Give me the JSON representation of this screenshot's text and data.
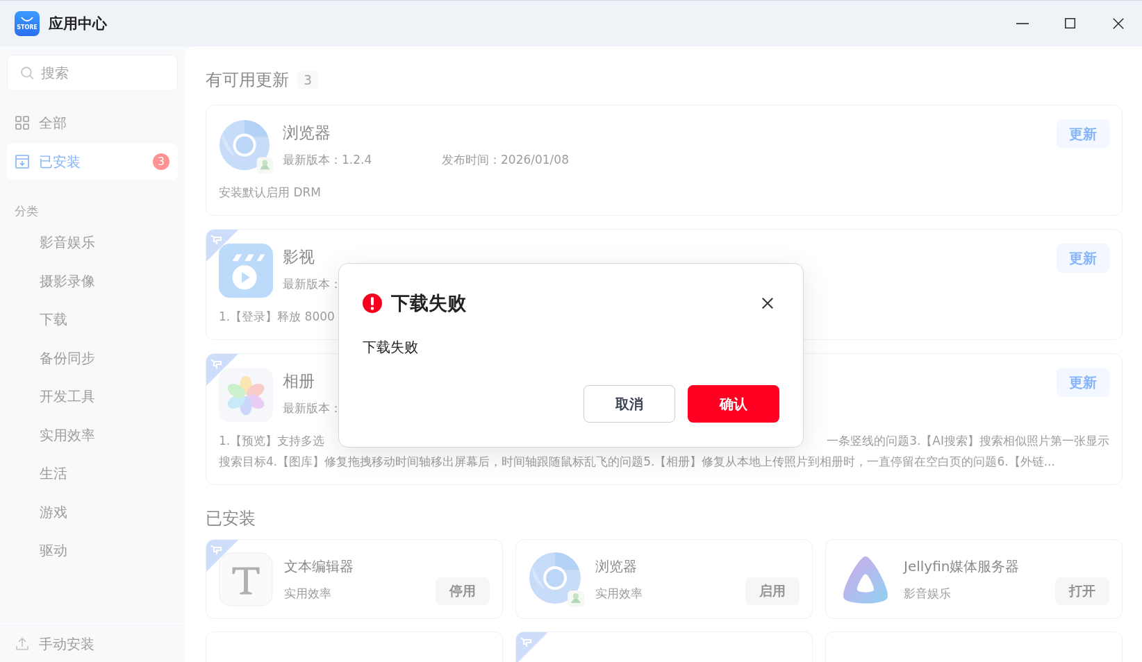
{
  "window": {
    "title": "应用中心",
    "logo_text": "STORE"
  },
  "sidebar": {
    "search": {
      "placeholder": "搜索"
    },
    "nav": [
      {
        "label": "全部",
        "selected": false
      },
      {
        "label": "已安装",
        "selected": true,
        "badge": "3"
      }
    ],
    "category_heading": "分类",
    "categories": [
      "影音娱乐",
      "摄影录像",
      "下载",
      "备份同步",
      "开发工具",
      "实用效率",
      "生活",
      "游戏",
      "驱动"
    ],
    "footer": "手动安装"
  },
  "updates": {
    "title": "有可用更新",
    "count": "3",
    "apps": [
      {
        "name": "浏览器",
        "kind": "browser",
        "tagged": false,
        "version": "最新版本：1.2.4",
        "released": "发布时间：2026/01/08",
        "description": [
          "安装默认启用 DRM"
        ],
        "button": "更新"
      },
      {
        "name": "影视",
        "kind": "video",
        "tagged": true,
        "version": "最新版本：",
        "description": [
          "1.【登录】释放 8000"
        ],
        "button": "更新"
      },
      {
        "name": "相册",
        "kind": "photos",
        "tagged": true,
        "version": "最新版本：",
        "description": [
          "1.【预览】支持多选",
          "一条竖线的问题3.【AI搜索】搜索相似照片第一张显示",
          "搜索目标4.【图库】修复拖拽移动时间轴移出屏幕后，时间轴跟随鼠标乱飞的问题5.【相册】修复从本地上传照片到相册时，一直停留在空白页的问题6.【外链..."
        ],
        "button": "更新"
      }
    ]
  },
  "installed": {
    "title": "已安装",
    "apps": [
      {
        "name": "文本编辑器",
        "kind": "text",
        "tagged": true,
        "category": "实用效率",
        "button": "停用"
      },
      {
        "name": "浏览器",
        "kind": "browser",
        "tagged": false,
        "category": "实用效率",
        "button": "启用"
      },
      {
        "name": "Jellyfin媒体服务器",
        "kind": "jellyfin",
        "tagged": false,
        "category": "影音娱乐",
        "button": "打开"
      }
    ],
    "more_cards": [
      {
        "tagged": false
      },
      {
        "tagged": true
      },
      {
        "tagged": false
      }
    ]
  },
  "dialog": {
    "title": "下载失败",
    "message": "下载失败",
    "cancel": "取消",
    "confirm": "确认"
  }
}
